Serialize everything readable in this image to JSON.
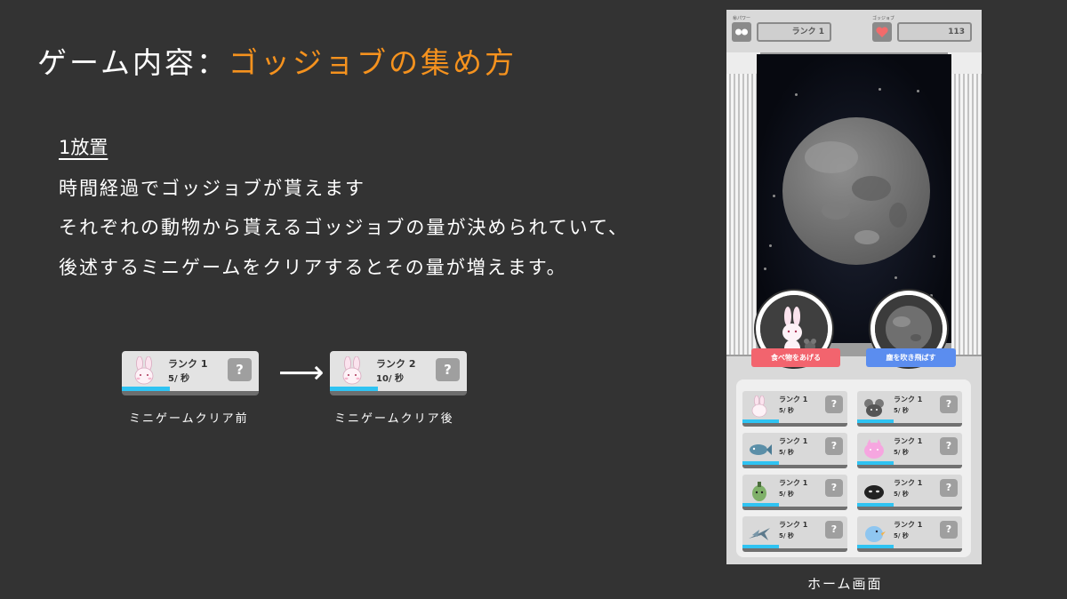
{
  "slide": {
    "title_prefix": "ゲーム内容：",
    "title_accent": "ゴッジョブの集め方",
    "section_heading": "1放置",
    "lines": [
      "時間経過でゴッジョブが貰えます",
      "それぞれの動物から貰えるゴッジョブの量が決められていて、",
      "後述するミニゲームをクリアするとその量が増えます。"
    ],
    "accent_color": "#f5921e",
    "progress_color": "#2fc3f2"
  },
  "examples": {
    "arrow": "⟶",
    "before": {
      "rank": "ランク 1",
      "rate": "5/ 秒",
      "help": "?",
      "caption": "ミニゲームクリア前",
      "progress": 0.35
    },
    "after": {
      "rank": "ランク 2",
      "rate": "10/ 秒",
      "help": "?",
      "caption": "ミニゲームクリア後",
      "progress": 0.35
    }
  },
  "home": {
    "caption": "ホーム画面",
    "top_left_label": "㊙パワー",
    "top_left_value": "ランク 1",
    "top_right_label": "ゴッジョブ",
    "gojob_count": "113",
    "feed_button": "食べ物をあげる",
    "blow_button": "塵を吹き飛ばす",
    "feed_color": "#f2646e",
    "blow_color": "#5b8def",
    "animals": [
      {
        "icon": "rabbit-icon",
        "rank": "ランク 1",
        "rate": "5/ 秒",
        "help": "?",
        "progress": 0.35
      },
      {
        "icon": "mouse-icon",
        "rank": "ランク 1",
        "rate": "5/ 秒",
        "help": "?",
        "progress": 0.35
      },
      {
        "icon": "fish-icon",
        "rank": "ランク 1",
        "rate": "5/ 秒",
        "help": "?",
        "progress": 0.35
      },
      {
        "icon": "pink-blob-icon",
        "rank": "ランク 1",
        "rate": "5/ 秒",
        "help": "?",
        "progress": 0.35
      },
      {
        "icon": "green-creature-icon",
        "rank": "ランク 1",
        "rate": "5/ 秒",
        "help": "?",
        "progress": 0.35
      },
      {
        "icon": "black-blob-icon",
        "rank": "ランク 1",
        "rate": "5/ 秒",
        "help": "?",
        "progress": 0.35
      },
      {
        "icon": "plane-icon",
        "rank": "ランク 1",
        "rate": "5/ 秒",
        "help": "?",
        "progress": 0.35
      },
      {
        "icon": "blue-bird-icon",
        "rank": "ランク 1",
        "rate": "5/ 秒",
        "help": "?",
        "progress": 0.35
      }
    ]
  }
}
